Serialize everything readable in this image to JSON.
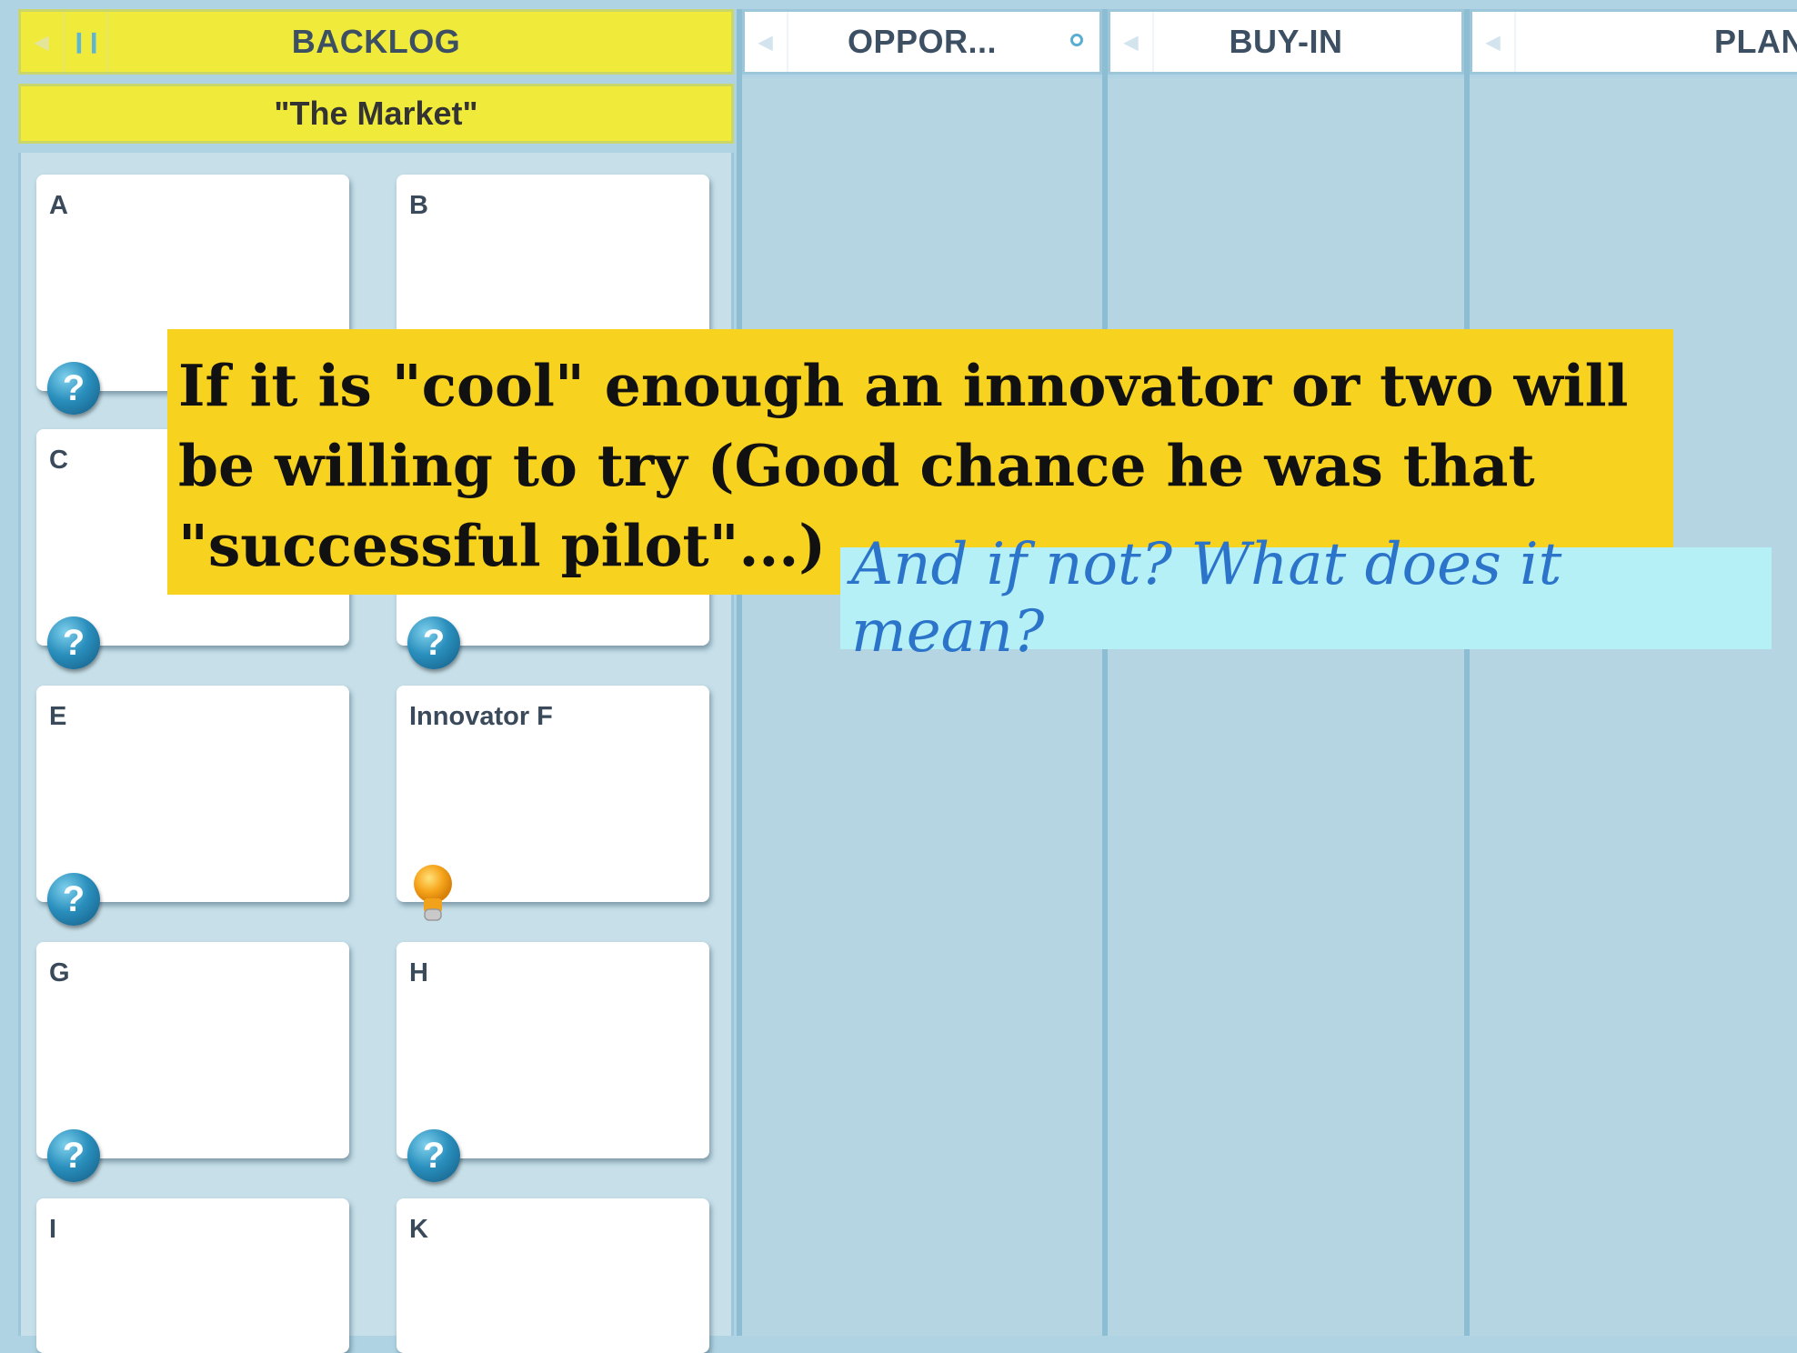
{
  "columns": [
    {
      "key": "backlog",
      "label": "BACKLOG"
    },
    {
      "key": "oppor",
      "label": "OPPOR..."
    },
    {
      "key": "buyin",
      "label": "BUY-IN"
    },
    {
      "key": "plan",
      "label": "PLAN"
    }
  ],
  "backlog": {
    "swimlane": "\"The Market\"",
    "cards": [
      {
        "title": "A",
        "icon": "question-icon"
      },
      {
        "title": "B",
        "icon": ""
      },
      {
        "title": "C",
        "icon": "question-icon"
      },
      {
        "title": "",
        "icon": "question-icon"
      },
      {
        "title": "E",
        "icon": "question-icon"
      },
      {
        "title": "Innovator F",
        "icon": "lightbulb-icon"
      },
      {
        "title": "G",
        "icon": "question-icon"
      },
      {
        "title": "H",
        "icon": "question-icon"
      },
      {
        "title": "I",
        "icon": ""
      },
      {
        "title": "K",
        "icon": ""
      }
    ]
  },
  "icons": {
    "question_glyph": "?"
  },
  "annotations": {
    "main": "If it is \"cool\" enough an innovator or two will be willing to try (Good chance he was that \"successful pilot\"...)",
    "followup": "And if not? What does it mean?"
  },
  "colors": {
    "lane": "#b5d5e2",
    "backlog_header": "#f0ea3b",
    "callout_main": "#f7d21f",
    "callout_followup": "#b4f0f6",
    "followup_text": "#2c74c9"
  }
}
